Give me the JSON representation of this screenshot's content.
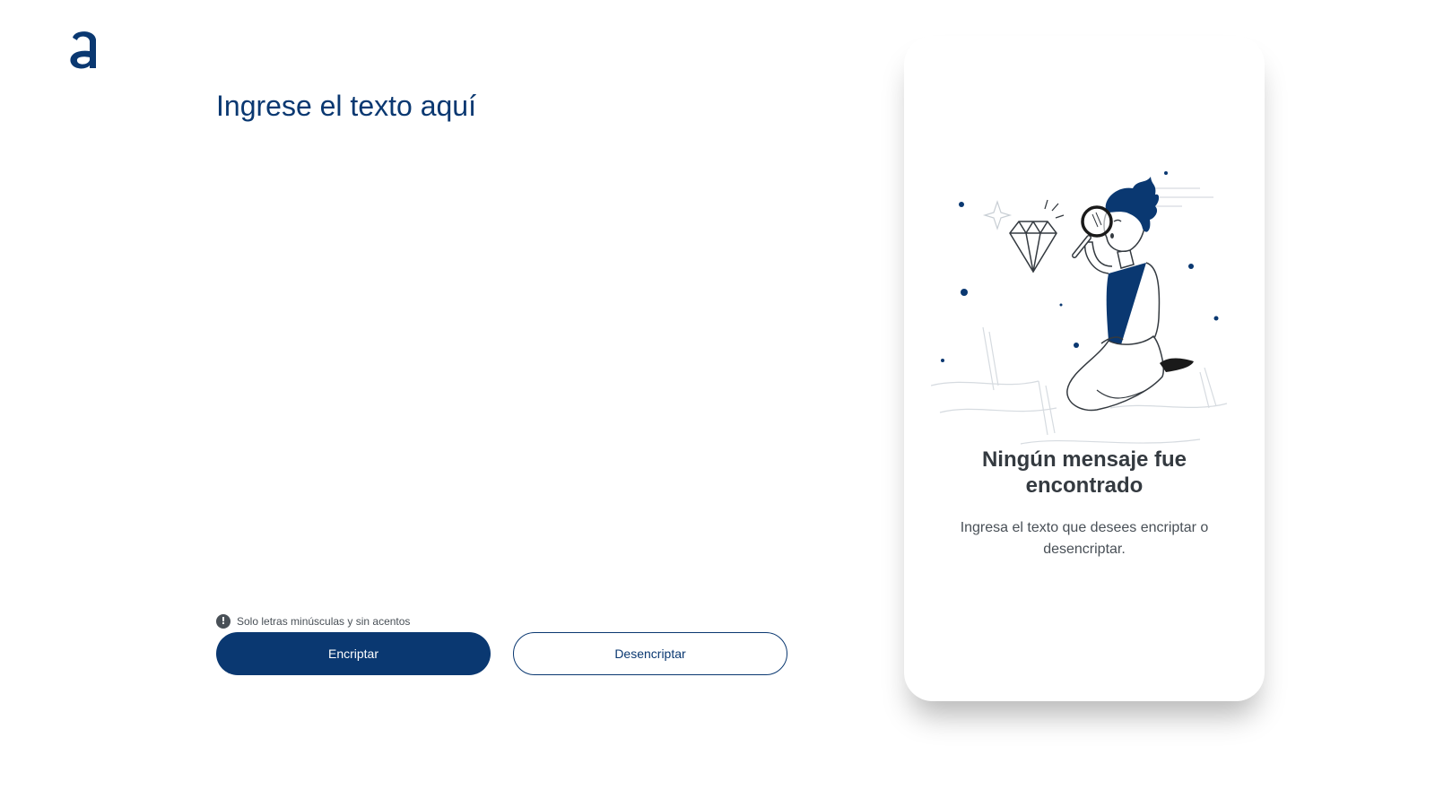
{
  "app": {
    "logo_icon": "alura-logo-icon",
    "accent_color": "#0a3871"
  },
  "input": {
    "placeholder": "Ingrese el texto aquí",
    "value": ""
  },
  "hint": {
    "icon": "exclamation-circle-icon",
    "text": "Solo letras minúsculas y sin acentos"
  },
  "buttons": {
    "encrypt_label": "Encriptar",
    "decrypt_label": "Desencriptar"
  },
  "output_panel": {
    "illustration": "person-with-magnifying-glass-illustration",
    "title": "Ningún mensaje fue encontrado",
    "subtitle": "Ingresa el texto que desees encriptar o desencriptar."
  }
}
